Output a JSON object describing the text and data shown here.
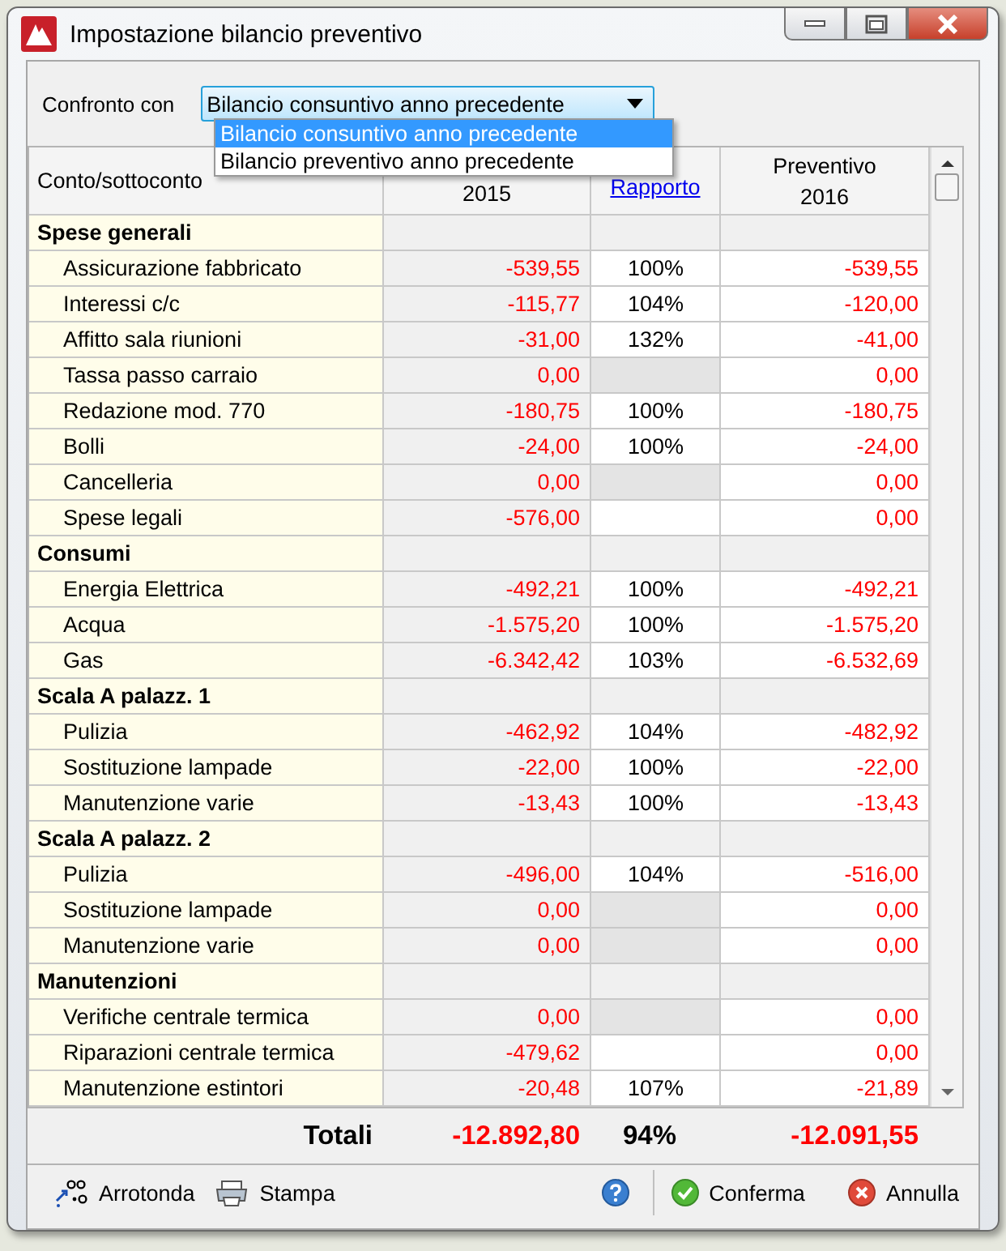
{
  "window": {
    "title": "Impostazione bilancio preventivo"
  },
  "compare": {
    "label": "Confronto con",
    "value": "Bilancio consuntivo anno precedente",
    "expanded": true,
    "options": [
      {
        "label": "Bilancio consuntivo anno precedente",
        "selected": true
      },
      {
        "label": "Bilancio preventivo anno precedente",
        "selected": false
      }
    ]
  },
  "table": {
    "columns": [
      {
        "kind": "text",
        "lines": [
          "Conto/sottoconto"
        ]
      },
      {
        "kind": "text",
        "lines": [
          "2015"
        ]
      },
      {
        "kind": "link",
        "lines": [
          "Rapporto"
        ]
      },
      {
        "kind": "text",
        "lines": [
          "Preventivo",
          "2016"
        ]
      }
    ],
    "rows": [
      {
        "kind": "group",
        "label": "Spese generali"
      },
      {
        "kind": "item",
        "label": "Assicurazione fabbricato",
        "value_2015": "-539,55",
        "ratio": "100%",
        "budget_2016": "-539,55",
        "greyed": false
      },
      {
        "kind": "item",
        "label": "Interessi c/c",
        "value_2015": "-115,77",
        "ratio": "104%",
        "budget_2016": "-120,00",
        "greyed": false
      },
      {
        "kind": "item",
        "label": "Affitto sala riunioni",
        "value_2015": "-31,00",
        "ratio": "132%",
        "budget_2016": "-41,00",
        "greyed": false
      },
      {
        "kind": "item",
        "label": "Tassa passo carraio",
        "value_2015": "0,00",
        "budget_2016": "0,00",
        "greyed": true
      },
      {
        "kind": "item",
        "label": "Redazione mod. 770",
        "value_2015": "-180,75",
        "ratio": "100%",
        "budget_2016": "-180,75",
        "greyed": false
      },
      {
        "kind": "item",
        "label": "Bolli",
        "value_2015": "-24,00",
        "ratio": "100%",
        "budget_2016": "-24,00",
        "greyed": false
      },
      {
        "kind": "item",
        "label": "Cancelleria",
        "value_2015": "0,00",
        "budget_2016": "0,00",
        "greyed": true
      },
      {
        "kind": "item",
        "label": "Spese legali",
        "value_2015": "-576,00",
        "budget_2016": "0,00",
        "greyed": false
      },
      {
        "kind": "group",
        "label": "Consumi"
      },
      {
        "kind": "item",
        "label": "Energia Elettrica",
        "value_2015": "-492,21",
        "ratio": "100%",
        "budget_2016": "-492,21",
        "greyed": false
      },
      {
        "kind": "item",
        "label": "Acqua",
        "value_2015": "-1.575,20",
        "ratio": "100%",
        "budget_2016": "-1.575,20",
        "greyed": false
      },
      {
        "kind": "item",
        "label": "Gas",
        "value_2015": "-6.342,42",
        "ratio": "103%",
        "budget_2016": "-6.532,69",
        "greyed": false
      },
      {
        "kind": "group",
        "label": "Scala A palazz. 1"
      },
      {
        "kind": "item",
        "label": "Pulizia",
        "value_2015": "-462,92",
        "ratio": "104%",
        "budget_2016": "-482,92",
        "greyed": false
      },
      {
        "kind": "item",
        "label": "Sostituzione lampade",
        "value_2015": "-22,00",
        "ratio": "100%",
        "budget_2016": "-22,00",
        "greyed": false
      },
      {
        "kind": "item",
        "label": "Manutenzione varie",
        "value_2015": "-13,43",
        "ratio": "100%",
        "budget_2016": "-13,43",
        "greyed": false
      },
      {
        "kind": "group",
        "label": "Scala A palazz. 2"
      },
      {
        "kind": "item",
        "label": "Pulizia",
        "value_2015": "-496,00",
        "ratio": "104%",
        "budget_2016": "-516,00",
        "greyed": false
      },
      {
        "kind": "item",
        "label": "Sostituzione lampade",
        "value_2015": "0,00",
        "budget_2016": "0,00",
        "greyed": true
      },
      {
        "kind": "item",
        "label": "Manutenzione varie",
        "value_2015": "0,00",
        "budget_2016": "0,00",
        "greyed": true
      },
      {
        "kind": "group",
        "label": "Manutenzioni"
      },
      {
        "kind": "item",
        "label": "Verifiche centrale termica",
        "value_2015": "0,00",
        "budget_2016": "0,00",
        "greyed": true
      },
      {
        "kind": "item",
        "label": "Riparazioni centrale termica",
        "value_2015": "-479,62",
        "budget_2016": "0,00",
        "greyed": false
      },
      {
        "kind": "item",
        "label": "Manutenzione estintori",
        "value_2015": "-20,48",
        "ratio": "107%",
        "budget_2016": "-21,89",
        "greyed": false
      }
    ]
  },
  "totals": {
    "label": "Totali",
    "value_2015": "-12.892,80",
    "ratio": "94%",
    "budget_2016": "-12.091,55"
  },
  "toolbar": [
    {
      "kind": "round",
      "label": "Arrotonda"
    },
    {
      "kind": "print",
      "label": "Stampa"
    },
    {
      "kind": "help"
    },
    {
      "kind": "confirm",
      "label": "Conferma"
    },
    {
      "kind": "cancel",
      "label": "Annulla"
    }
  ]
}
